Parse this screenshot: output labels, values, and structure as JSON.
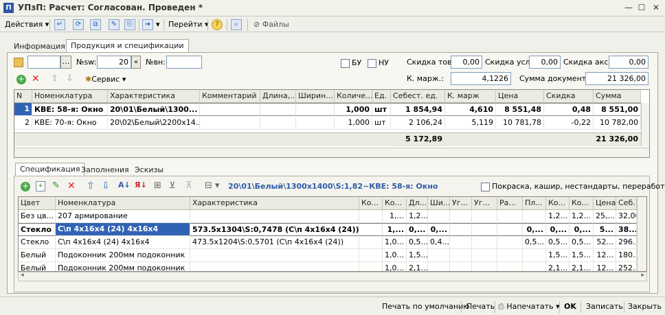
{
  "window": {
    "title": "УПзП: Расчет: Согласован. Проведен *"
  },
  "toolbar": {
    "actions": "Действия",
    "goto": "Перейти",
    "files": "Файлы"
  },
  "tabs": [
    "Информация",
    "Продукция и спецификации"
  ],
  "header_fields": {
    "nsw_label": "№sw:",
    "nsw_value": "20",
    "nvn_label": "№вн:",
    "nvn_value": "",
    "bu_label": "БУ",
    "nu_label": "НУ",
    "disc_goods_label": "Скидка тов.:",
    "disc_goods": "0,00",
    "disc_serv_label": "Скидка усл.:",
    "disc_serv": "0,00",
    "disc_promo_label": "Скидка акс.:",
    "disc_promo": "0,00",
    "kmarg_label": "К. марж.:",
    "kmarg": "4,1226",
    "docsum_label": "Сумма документа:",
    "docsum": "21 326,00"
  },
  "products": {
    "service_label": "Сервис",
    "columns": [
      "N",
      "Номенклатура",
      "Характеристика",
      "Комментарий",
      "Длина,...",
      "Ширин...",
      "Количе...",
      "Ед.",
      "Себест. ед.",
      "К. марж",
      "Цена",
      "Скидка",
      "Сумма"
    ],
    "rows": [
      [
        "1",
        "КВЕ: 58-я: Окно",
        "20\\01\\Белый\\1300...",
        "",
        "",
        "",
        "1,000",
        "шт",
        "1 854,94",
        "4,610",
        "8 551,48",
        "0,48",
        "8 551,00"
      ],
      [
        "2",
        "КВЕ: 70-я: Окно",
        "20\\02\\Белый\\2200x14...",
        "",
        "",
        "",
        "1,000",
        "шт",
        "2 106,24",
        "5,119",
        "10 781,78",
        "-0,22",
        "10 782,00"
      ]
    ],
    "totals": {
      "cost": "5 172,89",
      "sum": "21 326,00"
    }
  },
  "subtabs": [
    "Спецификация",
    "Заполнения",
    "Эскизы"
  ],
  "spec": {
    "path": "20\\01\\Белый\\1300x1400\\S:1,82~КВЕ: 58-я: Окно",
    "option_label": "Покраска, кашир, нестандарты, переработ...",
    "columns": [
      "Цвет",
      "Номенклатура",
      "Характеристика",
      "Ко...",
      "Ко...",
      "Дл...",
      "Ши...",
      "Уг...",
      "Уг...",
      "Ра...",
      "Пл...",
      "Ко...",
      "Ко...",
      "Цена",
      "Себ..."
    ],
    "rows": [
      [
        "Без цв...",
        "207 армирование",
        "",
        "",
        "1,...",
        "1,2...",
        "",
        "",
        "",
        "",
        "",
        "1,2...",
        "1,2...",
        "25,...",
        "32,00"
      ],
      [
        "Стекло",
        "С\\п 4х16х4 (24) 4х16х4",
        "573.5x1304\\S:0,7478 (С\\п 4х16х4 (24))",
        "",
        "1,...",
        "0,...",
        "0,...",
        "",
        "",
        "",
        "0,...",
        "0,...",
        "0,...",
        "5...",
        "38..."
      ],
      [
        "Стекло",
        "С\\п 4х16х4 (24) 4х16х4",
        "473.5x1204\\S:0,5701 (С\\п 4х16х4 (24))",
        "",
        "1,0...",
        "0,5...",
        "0,4...",
        "",
        "",
        "",
        "0,5...",
        "0,5...",
        "0,5...",
        "52...",
        "296..."
      ],
      [
        "Белый",
        "Подоконник 200мм подоконник",
        "",
        "",
        "1,0...",
        "1,5...",
        "",
        "",
        "",
        "",
        "",
        "1,5...",
        "1,5...",
        "12...",
        "180..."
      ],
      [
        "Белый",
        "Подоконник 200мм подоконник",
        "",
        "",
        "1,0...",
        "2,1...",
        "",
        "",
        "",
        "",
        "",
        "2,1...",
        "2,1...",
        "12...",
        "252..."
      ]
    ]
  },
  "bottom": {
    "print_default": "Печать по умолчанию",
    "print": "Печать",
    "print_to": "Напечатать",
    "ok": "OK",
    "save": "Записать",
    "close": "Закрыть"
  }
}
